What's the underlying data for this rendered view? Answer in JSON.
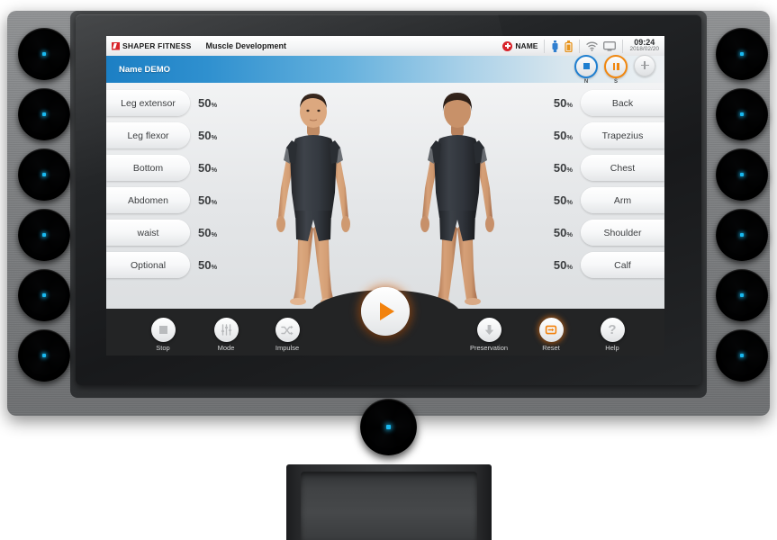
{
  "statusbar": {
    "brand": "SHAPER FITNESS",
    "title": "Muscle Development",
    "user_badge_label": "NAME",
    "icons": [
      "usb-icon",
      "battery-icon",
      "wifi-icon",
      "monitor-icon"
    ],
    "time": "09:24",
    "date": "2018/02/20"
  },
  "namebar": {
    "label": "Name DEMO",
    "controls": [
      {
        "name": "stop-circle-button",
        "label": "N",
        "icon": "square-icon",
        "ring": "#1f7fd0"
      },
      {
        "name": "pause-circle-button",
        "label": "S",
        "icon": "pause-icon",
        "ring": "#f0870f"
      },
      {
        "name": "add-circle-button",
        "label": "",
        "icon": "plus-icon",
        "ring": "#cfd1d3"
      }
    ]
  },
  "left_channels": [
    {
      "label": "Leg extensor",
      "value": "50",
      "unit": "%"
    },
    {
      "label": "Leg flexor",
      "value": "50",
      "unit": "%"
    },
    {
      "label": "Bottom",
      "value": "50",
      "unit": "%"
    },
    {
      "label": "Abdomen",
      "value": "50",
      "unit": "%"
    },
    {
      "label": "waist",
      "value": "50",
      "unit": "%"
    },
    {
      "label": "Optional",
      "value": "50",
      "unit": "%"
    }
  ],
  "right_channels": [
    {
      "label": "Back",
      "value": "50",
      "unit": "%"
    },
    {
      "label": "Trapezius",
      "value": "50",
      "unit": "%"
    },
    {
      "label": "Chest",
      "value": "50",
      "unit": "%"
    },
    {
      "label": "Arm",
      "value": "50",
      "unit": "%"
    },
    {
      "label": "Shoulder",
      "value": "50",
      "unit": "%"
    },
    {
      "label": "Calf",
      "value": "50",
      "unit": "%"
    }
  ],
  "avatars": {
    "front_view": "male-avatar-front",
    "back_view": "male-avatar-back",
    "suit_color": "#32363c",
    "skin_color": "#d7a078"
  },
  "toolbar": {
    "left_items": [
      {
        "label": "Stop",
        "icon": "stop-square-icon"
      },
      {
        "label": "Mode",
        "icon": "sliders-icon"
      },
      {
        "label": "Impulse",
        "icon": "shuffle-icon"
      }
    ],
    "right_items": [
      {
        "label": "Preservation",
        "icon": "download-arrow-icon"
      },
      {
        "label": "Reset",
        "icon": "reset-loop-icon"
      },
      {
        "label": "Help",
        "icon": "question-mark-icon"
      }
    ],
    "play": {
      "label": "",
      "icon": "play-triangle-icon"
    }
  },
  "device": {
    "knob_count_left": 6,
    "knob_count_right": 6,
    "knob_led_color": "#19b9f0",
    "accent_orange": "#f2820d",
    "accent_blue": "#1f7fd0"
  }
}
